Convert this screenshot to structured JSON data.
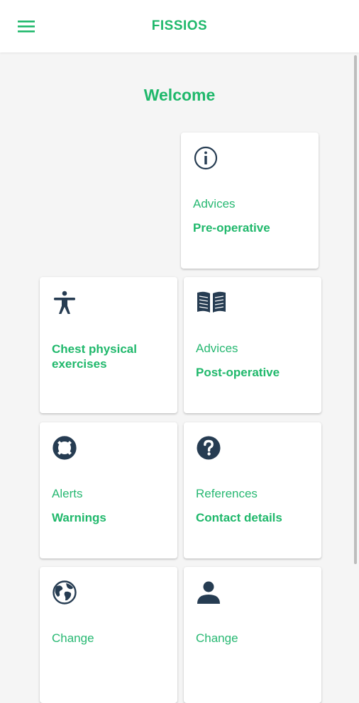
{
  "app_title": "FISSIOS",
  "welcome": "Welcome",
  "colors": {
    "accent": "#1fb86b",
    "icon": "#263c52",
    "background": "#f5f5f5"
  },
  "cards": [
    {
      "icon": "info-circle-icon",
      "subtitle": "Advices",
      "title": "Pre-operative"
    },
    {
      "icon": "person-accessibility-icon",
      "subtitle": "",
      "title": "Chest physical exercises"
    },
    {
      "icon": "open-book-icon",
      "subtitle": "Advices",
      "title": "Post-operative"
    },
    {
      "icon": "life-buoy-icon",
      "subtitle": "Alerts",
      "title": "Warnings"
    },
    {
      "icon": "question-circle-icon",
      "subtitle": "References",
      "title": "Contact details"
    },
    {
      "icon": "globe-icon",
      "subtitle": "Change",
      "title": ""
    },
    {
      "icon": "person-icon",
      "subtitle": "Change",
      "title": ""
    }
  ]
}
